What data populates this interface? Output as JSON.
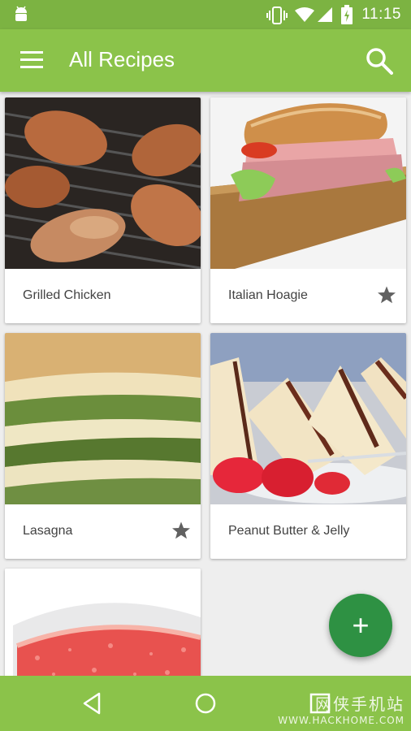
{
  "status_bar": {
    "time": "11:15"
  },
  "app_bar": {
    "title": "All Recipes"
  },
  "recipes": [
    {
      "name": "Grilled Chicken",
      "favorite": false
    },
    {
      "name": "Italian Hoagie",
      "favorite": true
    },
    {
      "name": "Lasagna",
      "favorite": true
    },
    {
      "name": "Peanut Butter & Jelly",
      "favorite": false
    },
    {
      "name": "",
      "favorite": false
    }
  ],
  "fab": {
    "label": "+"
  },
  "watermark": {
    "line1": "网侠手机站",
    "line2": "WWW.HACKHOME.COM"
  },
  "colors": {
    "primary": "#8bc34a",
    "status": "#7cb342",
    "fab": "#2e9143"
  }
}
